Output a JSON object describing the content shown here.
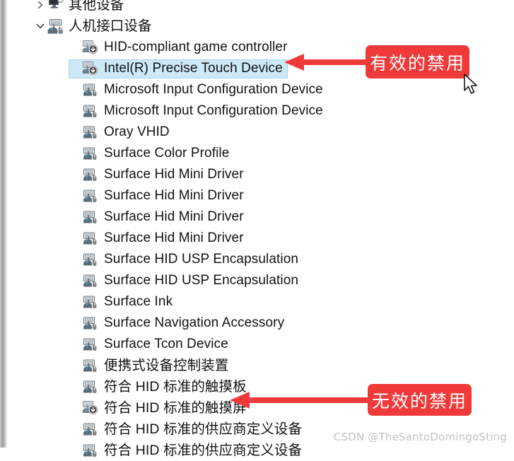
{
  "window": {
    "app": "device-manager",
    "accent_color": "#f03a3a",
    "selection_color": "#cde8f7",
    "selection_border_color": "#a9d4ee"
  },
  "tree": {
    "nodes": [
      {
        "label": "其他设备",
        "level": 1,
        "chevron": "collapsed",
        "icon": "other-device-icon",
        "disabled": false,
        "selected": false,
        "clipped_top": true
      },
      {
        "label": "人机接口设备",
        "level": 1,
        "chevron": "expanded",
        "icon": "hid-group-icon",
        "disabled": false,
        "selected": false
      },
      {
        "label": "HID-compliant game controller",
        "level": 2,
        "chevron": "none",
        "icon": "hid-device-disabled-icon",
        "disabled": true,
        "selected": false
      },
      {
        "label": "Intel(R) Precise Touch Device",
        "level": 2,
        "chevron": "none",
        "icon": "hid-device-disabled-icon",
        "disabled": true,
        "selected": true
      },
      {
        "label": "Microsoft Input Configuration Device",
        "level": 2,
        "chevron": "none",
        "icon": "hid-device-icon",
        "disabled": false,
        "selected": false
      },
      {
        "label": "Microsoft Input Configuration Device",
        "level": 2,
        "chevron": "none",
        "icon": "hid-device-icon",
        "disabled": false,
        "selected": false
      },
      {
        "label": "Oray VHID",
        "level": 2,
        "chevron": "none",
        "icon": "hid-device-icon",
        "disabled": false,
        "selected": false
      },
      {
        "label": "Surface Color Profile",
        "level": 2,
        "chevron": "none",
        "icon": "hid-device-icon",
        "disabled": false,
        "selected": false
      },
      {
        "label": "Surface Hid Mini Driver",
        "level": 2,
        "chevron": "none",
        "icon": "hid-device-icon",
        "disabled": false,
        "selected": false
      },
      {
        "label": "Surface Hid Mini Driver",
        "level": 2,
        "chevron": "none",
        "icon": "hid-device-icon",
        "disabled": false,
        "selected": false
      },
      {
        "label": "Surface Hid Mini Driver",
        "level": 2,
        "chevron": "none",
        "icon": "hid-device-icon",
        "disabled": false,
        "selected": false
      },
      {
        "label": "Surface Hid Mini Driver",
        "level": 2,
        "chevron": "none",
        "icon": "hid-device-icon",
        "disabled": false,
        "selected": false
      },
      {
        "label": "Surface HID USP Encapsulation",
        "level": 2,
        "chevron": "none",
        "icon": "hid-device-icon",
        "disabled": false,
        "selected": false
      },
      {
        "label": "Surface HID USP Encapsulation",
        "level": 2,
        "chevron": "none",
        "icon": "hid-device-icon",
        "disabled": false,
        "selected": false
      },
      {
        "label": "Surface Ink",
        "level": 2,
        "chevron": "none",
        "icon": "hid-device-icon",
        "disabled": false,
        "selected": false
      },
      {
        "label": "Surface Navigation Accessory",
        "level": 2,
        "chevron": "none",
        "icon": "hid-device-icon",
        "disabled": false,
        "selected": false
      },
      {
        "label": "Surface Tcon Device",
        "level": 2,
        "chevron": "none",
        "icon": "hid-device-icon",
        "disabled": false,
        "selected": false
      },
      {
        "label": "便携式设备控制装置",
        "level": 2,
        "chevron": "none",
        "icon": "hid-device-icon",
        "disabled": false,
        "selected": false
      },
      {
        "label": "符合 HID 标准的触摸板",
        "level": 2,
        "chevron": "none",
        "icon": "hid-device-icon",
        "disabled": false,
        "selected": false
      },
      {
        "label": "符合 HID 标准的触摸屏",
        "level": 2,
        "chevron": "none",
        "icon": "hid-device-disabled-icon",
        "disabled": true,
        "selected": false
      },
      {
        "label": "符合 HID 标准的供应商定义设备",
        "level": 2,
        "chevron": "none",
        "icon": "hid-device-icon",
        "disabled": false,
        "selected": false
      },
      {
        "label": "符合 HID 标准的供应商定义设备",
        "level": 2,
        "chevron": "none",
        "icon": "hid-device-icon",
        "disabled": false,
        "selected": false,
        "clipped_bottom": true
      }
    ]
  },
  "annotations": {
    "callouts": [
      {
        "text": "有效的禁用",
        "target_row_label": "Intel(R) Precise Touch Device"
      },
      {
        "text": "无效的禁用",
        "target_row_label": "符合 HID 标准的触摸屏"
      }
    ],
    "cursor": "mouse-pointer"
  },
  "watermark": {
    "text": "CSDN @TheSantoDomingoSting"
  }
}
